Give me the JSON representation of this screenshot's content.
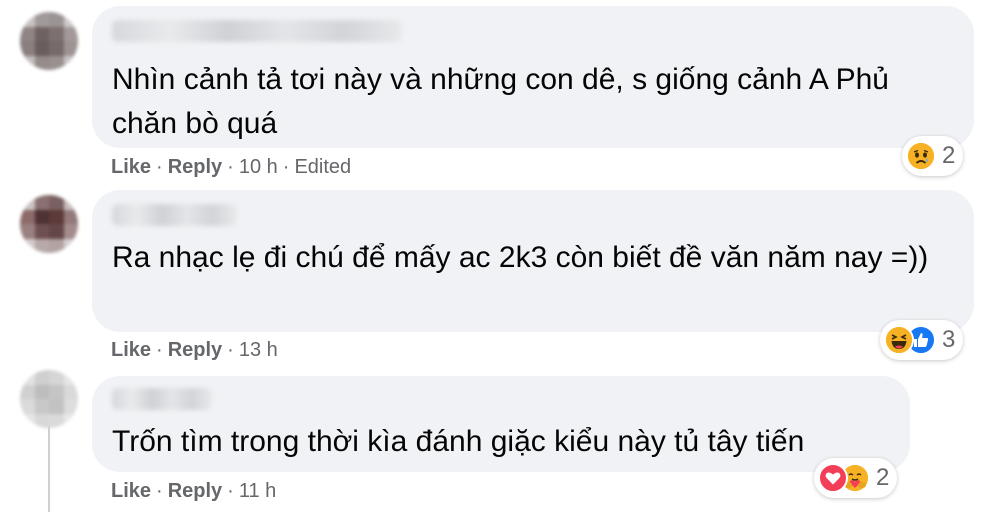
{
  "comments": [
    {
      "text": "Nhìn cảnh tả tơi này và những con dê, s giống cảnh A Phủ chăn bò quá",
      "like_label": "Like",
      "reply_label": "Reply",
      "time": "10 h",
      "edited_label": "Edited",
      "reactions": [
        "sad"
      ],
      "reaction_count": "2"
    },
    {
      "text": "Ra nhạc lẹ đi chú để mấy ac 2k3 còn biết đề văn năm nay =))",
      "like_label": "Like",
      "reply_label": "Reply",
      "time": "13 h",
      "reactions": [
        "haha",
        "like"
      ],
      "reaction_count": "3"
    },
    {
      "text": "Trốn tìm trong thời kìa đánh giặc kiểu này tủ tây tiến",
      "like_label": "Like",
      "reply_label": "Reply",
      "time": "11 h",
      "reactions": [
        "love",
        "care"
      ],
      "reaction_count": "2"
    }
  ],
  "colors": {
    "bubble": "#f0f2f5",
    "meta_text": "#65676b",
    "text": "#050505",
    "like_blue": "#1877f2",
    "love_red": "#f33e58",
    "emoji_yellow": "#f7b125"
  }
}
